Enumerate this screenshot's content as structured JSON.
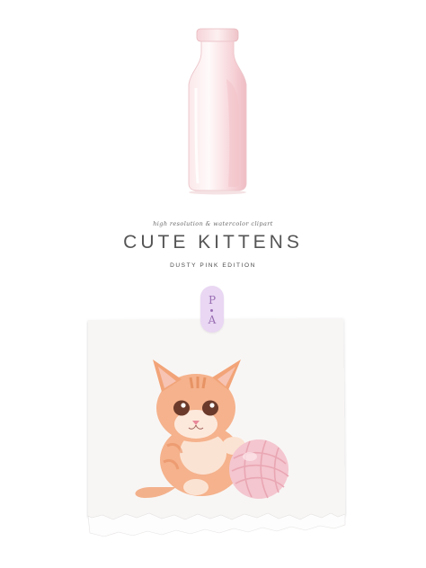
{
  "header": {
    "subtitle": "high resolution & watercolor clipart",
    "title": "CUTE KITTENS",
    "edition": "DUSTY PINK EDITION"
  },
  "badge": {
    "letter_top": "P",
    "letter_bottom": "A"
  },
  "illustrations": {
    "bottle": "milk-bottle",
    "kitten": "kitten-with-yarn-ball"
  },
  "colors": {
    "background": "#ffffff",
    "badge": "#e9d7f3",
    "accent_pink": "#f3c2c9",
    "kitten_orange": "#f2a478"
  }
}
